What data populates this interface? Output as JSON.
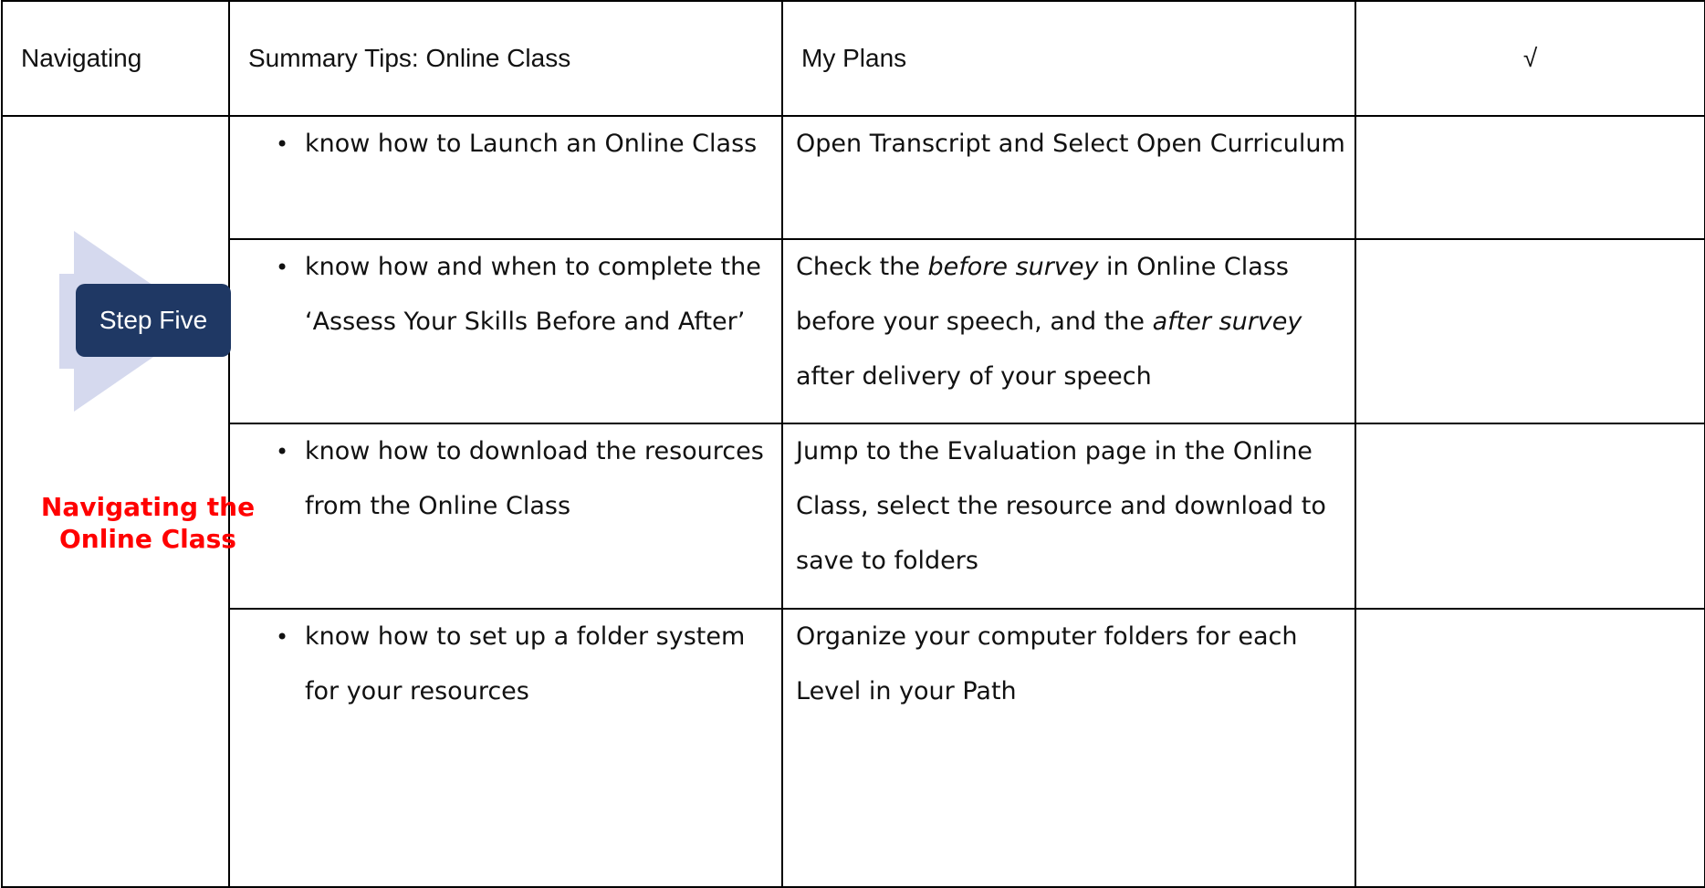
{
  "header": {
    "col1": "Navigating",
    "col2": "Summary Tips:  Online Class",
    "col3": "My Plans",
    "col4": "√"
  },
  "step": {
    "label": "Step Five",
    "title": "Navigating the Online Class",
    "box_color": "#1f3864",
    "arrow_color": "#d5d9ee",
    "title_color": "#ff0000"
  },
  "rows": [
    {
      "tip": "know how to Launch an Online Class",
      "plan": "Open Transcript and Select Open Curriculum"
    },
    {
      "tip": "know how and when to complete the ‘Assess Your Skills Before and After’",
      "plan_parts": [
        "Check the ",
        "before survey",
        " in Online Class before your speech, and the ",
        "after survey",
        " after delivery of your speech"
      ]
    },
    {
      "tip": "know how to download the resources from the Online Class",
      "plan": "Jump to the Evaluation page in the Online Class, select the resource and download to save to folders"
    },
    {
      "tip": "know how to set up a folder system for your resources",
      "plan": "Organize your computer folders for each Level in your Path"
    }
  ],
  "bullet_glyph": "•"
}
